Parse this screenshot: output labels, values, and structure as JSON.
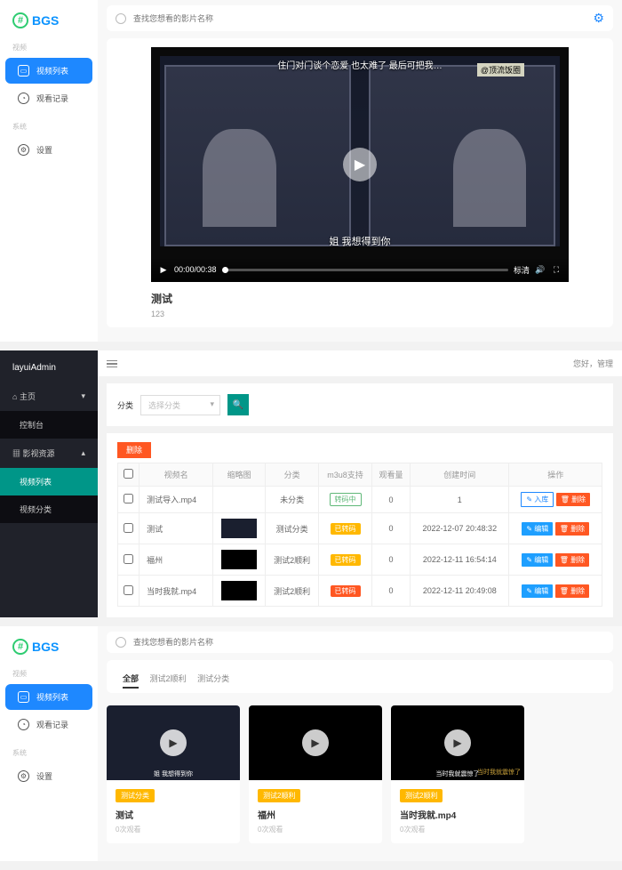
{
  "brand": {
    "name": "BGS"
  },
  "front_nav": {
    "cat1": "视频",
    "cat2": "系统",
    "items": {
      "video_list": "视频列表",
      "watch_history": "观看记录",
      "settings": "设置"
    }
  },
  "search": {
    "placeholder": "查找您想看的影片名称"
  },
  "player": {
    "top_sub": "住门对门谈个恋爱 也太难了 最后可把我…",
    "watermark": "@顶流饭圈",
    "bottom_sub": "姐 我想得到你",
    "time": "00:00/00:38",
    "label_right": "标清"
  },
  "detail": {
    "title": "测试",
    "desc": "123"
  },
  "admin": {
    "brand": "layuiAdmin",
    "greeting": "您好，管理",
    "menu": {
      "home": "主页",
      "dashboard": "控制台",
      "media": "影视资源",
      "video_list": "视频列表",
      "video_cat": "视频分类"
    },
    "filter_label": "分类",
    "filter_placeholder": "选择分类",
    "btn_delete": "删除",
    "table": {
      "h": {
        "name": "视频名",
        "thumb": "缩略图",
        "cat": "分类",
        "m3u8": "m3u8支持",
        "views": "观看量",
        "ctime": "创建时间",
        "ops": "操作"
      },
      "btn_import": "入库",
      "btn_edit": "编辑",
      "btn_del": "删除",
      "m3u8_yes": "转码中",
      "m3u8_done": "已转码",
      "m3u8_no": "已转码",
      "rows": [
        {
          "name": "测试导入.mp4",
          "cat": "未分类",
          "m3u8": "转码中",
          "m3u8_cls": "tag-green",
          "views": "0",
          "n": "1",
          "ctime": "",
          "import": true
        },
        {
          "name": "测试",
          "cat": "测试分类",
          "m3u8": "已转码",
          "m3u8_cls": "tag-orange",
          "views": "0",
          "n": "",
          "ctime": "2022-12-07 20:48:32",
          "import": false
        },
        {
          "name": "福州",
          "cat": "测试2顺利",
          "m3u8": "已转码",
          "m3u8_cls": "tag-orange",
          "views": "0",
          "n": "",
          "ctime": "2022-12-11 16:54:14",
          "import": false
        },
        {
          "name": "当时我就.mp4",
          "cat": "测试2顺利",
          "m3u8": "已转码",
          "m3u8_cls": "tag-red",
          "views": "0",
          "n": "",
          "ctime": "2022-12-11 20:49:08",
          "import": false
        }
      ]
    }
  },
  "grid": {
    "tabs": {
      "all": "全部",
      "t1": "测试2顺利",
      "t2": "测试分类"
    },
    "cards": [
      {
        "tag": "测试分类",
        "title": "测试",
        "meta": "0次观看",
        "dark": false,
        "cap": "姐 我想得到你"
      },
      {
        "tag": "测试2顺利",
        "title": "福州",
        "meta": "0次观看",
        "dark": true,
        "cap": ""
      },
      {
        "tag": "测试2顺利",
        "title": "当时我就.mp4",
        "meta": "0次观看",
        "dark": true,
        "cap": "当时我就震惊了",
        "wm": true
      }
    ]
  }
}
